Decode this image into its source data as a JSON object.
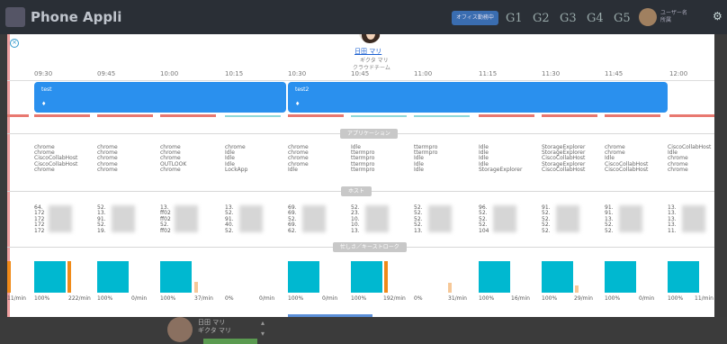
{
  "background": {
    "app_title": "Phone Appli",
    "status_pill": "オフィス勤務中",
    "groups": [
      "G1",
      "G2",
      "G3",
      "G4",
      "G5"
    ],
    "user_lines": [
      "ユーザー名",
      "所属"
    ]
  },
  "profile": {
    "name": "日田 マリ",
    "kana": "ギクタ マリ",
    "team": "クラウドチーム"
  },
  "timeline": {
    "times": [
      "09:30",
      "09:45",
      "10:00",
      "10:15",
      "10:30",
      "10:45",
      "11:00",
      "11:15",
      "11:30",
      "11:45",
      "12:00"
    ],
    "events": [
      {
        "title": "test",
        "pin": "♦"
      },
      {
        "title": "test2",
        "pin": "♦"
      }
    ]
  },
  "sections": {
    "apps": "アプリケーション",
    "host": "ホスト",
    "busy": "忙しさ／キーストローク"
  },
  "applications": [
    [
      "chrome",
      "chrome",
      "CiscoCollabHost",
      "CiscoCollabHost",
      "chrome"
    ],
    [
      "chrome",
      "chrome",
      "chrome",
      "chrome",
      "chrome"
    ],
    [
      "chrome",
      "chrome",
      "chrome",
      "OUTLOOK",
      "chrome"
    ],
    [
      "chrome",
      "Idle",
      "Idle",
      "Idle",
      "LockApp"
    ],
    [
      "chrome",
      "chrome",
      "chrome",
      "chrome",
      "Idle"
    ],
    [
      "Idle",
      "ttermpro",
      "ttermpro",
      "ttermpro",
      "ttermpro"
    ],
    [
      "ttermpro",
      "ttermpro",
      "Idle",
      "Idle",
      "Idle"
    ],
    [
      "Idle",
      "Idle",
      "Idle",
      "Idle",
      "StorageExplorer"
    ],
    [
      "StorageExplorer",
      "StorageExplorer",
      "CiscoCollabHost",
      "StorageExplorer",
      "CiscoCollabHost"
    ],
    [
      "chrome",
      "chrome",
      "Idle",
      "CiscoCollabHost",
      "CiscoCollabHost"
    ],
    [
      "CiscoCollabHost",
      "Idle",
      "chrome",
      "chrome",
      "chrome"
    ]
  ],
  "hosts": [
    [
      "64.",
      "172",
      "172",
      "172",
      "172"
    ],
    [
      "52.",
      "13.",
      "91.",
      "52.",
      "19."
    ],
    [
      "13.",
      "ff02",
      "ff02",
      "52.",
      "ff02"
    ],
    [
      "13.",
      "52.",
      "91.",
      "40.",
      "52."
    ],
    [
      "69.",
      "69.",
      "52.",
      "69.",
      "62."
    ],
    [
      "52.",
      "23.",
      "10.",
      "10.",
      "13."
    ],
    [
      "52.",
      "52.",
      "52.",
      "52.",
      "13."
    ],
    [
      "96.",
      "52.",
      "52.",
      "52.",
      "104"
    ],
    [
      "91.",
      "52.",
      "52.",
      "52.",
      "52."
    ],
    [
      "91.",
      "91.",
      "13.",
      "52.",
      "52."
    ],
    [
      "13.",
      "13.",
      "13.",
      "13.",
      "11."
    ]
  ],
  "busy_stats": [
    {
      "pct": "100%",
      "rate": "222/min"
    },
    {
      "pct": "100%",
      "rate": "0/min"
    },
    {
      "pct": "100%",
      "rate": "37/min"
    },
    {
      "pct": "0%",
      "rate": "0/min"
    },
    {
      "pct": "100%",
      "rate": "0/min"
    },
    {
      "pct": "100%",
      "rate": "192/min"
    },
    {
      "pct": "0%",
      "rate": "31/min"
    },
    {
      "pct": "100%",
      "rate": "16/min"
    },
    {
      "pct": "100%",
      "rate": "29/min"
    },
    {
      "pct": "100%",
      "rate": "0/min"
    },
    {
      "pct": "100%",
      "rate": "11/min"
    }
  ],
  "edge_rate": "11/min",
  "colors": {
    "busy": "#00b8d0",
    "keystroke": "#f08a18",
    "event": "#2a90ee"
  }
}
